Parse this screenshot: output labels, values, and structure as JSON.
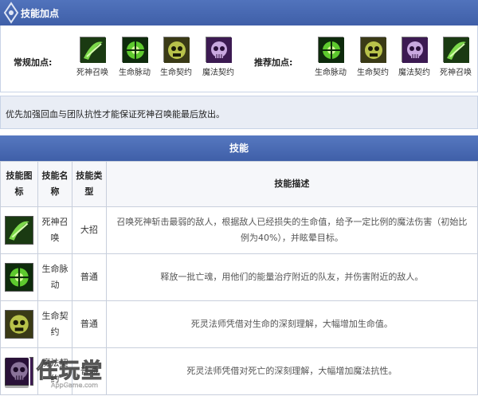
{
  "header": {
    "title": "技能加点"
  },
  "points": {
    "regular_label": "常规加点:",
    "recommended_label": "推荐加点:",
    "regular": [
      {
        "name": "死神召唤",
        "icon": "scythe-icon"
      },
      {
        "name": "生命脉动",
        "icon": "pulse-icon"
      },
      {
        "name": "生命契约",
        "icon": "pact-icon"
      },
      {
        "name": "魔法契约",
        "icon": "skull-icon"
      }
    ],
    "recommended": [
      {
        "name": "生命脉动",
        "icon": "pulse-icon"
      },
      {
        "name": "生命契约",
        "icon": "pact-icon"
      },
      {
        "name": "魔法契约",
        "icon": "skull-icon"
      },
      {
        "name": "死神召唤",
        "icon": "scythe-icon"
      }
    ]
  },
  "tip": {
    "text": "优先加强回血与团队抗性才能保证死神召唤能最后放出。"
  },
  "skills_section": {
    "title": "技能"
  },
  "table": {
    "headers": {
      "icon": "技能图标",
      "name": "技能名称",
      "type": "技能类型",
      "desc": "技能描述"
    },
    "rows": [
      {
        "name": "死神召唤",
        "type": "大招",
        "desc": "召唤死神斩击最弱的敌人，根据敌人已经损失的生命值，给予一定比例的魔法伤害（初始比例为40%），并眩晕目标。",
        "icon": "scythe-icon"
      },
      {
        "name": "生命脉动",
        "type": "普通",
        "desc": "释放一批亡魂，用他们的能量治疗附近的队友，并伤害附近的敌人。",
        "icon": "pulse-icon"
      },
      {
        "name": "生命契约",
        "type": "普通",
        "desc": "死灵法师凭借对生命的深刻理解，大幅增加生命值。",
        "icon": "pact-icon"
      },
      {
        "name": "魔法契约",
        "type": "普通",
        "desc": "死灵法师凭借对死亡的深刻理解，大幅增加魔法抗性。",
        "icon": "skull-icon"
      }
    ]
  },
  "watermark": {
    "text": "任玩堂",
    "sub": "AppGame.com"
  },
  "colors": {
    "header_blue": "#4566b0",
    "tip_bg": "#e9edf5",
    "table_border": "#c8cfdc"
  }
}
